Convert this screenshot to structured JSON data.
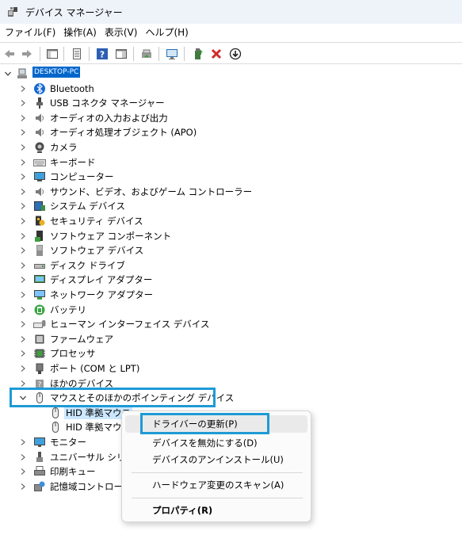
{
  "window": {
    "title": "デバイス マネージャー"
  },
  "menu": [
    "ファイル(F)",
    "操作(A)",
    "表示(V)",
    "ヘルプ(H)"
  ],
  "toolbar": {
    "icons": [
      "back-arrow-icon",
      "forward-arrow-icon",
      "show-hide-console-tree-icon",
      "properties-icon",
      "help-icon",
      "action-pane-icon",
      "update-driver-icon",
      "scan-hardware-icon",
      "enable-device-icon",
      "uninstall-device-icon",
      "disable-device-icon"
    ]
  },
  "tree": {
    "root_label": "DESKTOP-PC",
    "categories": [
      {
        "label": "Bluetooth",
        "icon": "bluetooth-icon"
      },
      {
        "label": "USB コネクタ マネージャー",
        "icon": "usb-connector-icon"
      },
      {
        "label": "オーディオの入力および出力",
        "icon": "speaker-icon"
      },
      {
        "label": "オーディオ処理オブジェクト (APO)",
        "icon": "speaker-icon"
      },
      {
        "label": "カメラ",
        "icon": "camera-icon"
      },
      {
        "label": "キーボード",
        "icon": "keyboard-icon"
      },
      {
        "label": "コンピューター",
        "icon": "computer-icon"
      },
      {
        "label": "サウンド、ビデオ、およびゲーム コントローラー",
        "icon": "speaker-icon"
      },
      {
        "label": "システム デバイス",
        "icon": "system-devices-icon"
      },
      {
        "label": "セキュリティ デバイス",
        "icon": "security-device-icon"
      },
      {
        "label": "ソフトウェア コンポーネント",
        "icon": "software-component-icon"
      },
      {
        "label": "ソフトウェア デバイス",
        "icon": "software-device-icon"
      },
      {
        "label": "ディスク ドライブ",
        "icon": "disk-drive-icon"
      },
      {
        "label": "ディスプレイ アダプター",
        "icon": "display-adapter-icon"
      },
      {
        "label": "ネットワーク アダプター",
        "icon": "network-adapter-icon"
      },
      {
        "label": "バッテリ",
        "icon": "battery-icon"
      },
      {
        "label": "ヒューマン インターフェイス デバイス",
        "icon": "hid-icon"
      },
      {
        "label": "ファームウェア",
        "icon": "firmware-icon"
      },
      {
        "label": "プロセッサ",
        "icon": "processor-icon"
      },
      {
        "label": "ポート (COM と LPT)",
        "icon": "port-icon"
      },
      {
        "label": "ほかのデバイス",
        "icon": "other-devices-icon"
      },
      {
        "label": "マウスとそのほかのポインティング デバイス",
        "icon": "mouse-icon",
        "expanded": true
      },
      {
        "label": "HID 準拠マウス",
        "icon": "mouse-icon",
        "child": true,
        "selected": true
      },
      {
        "label": "HID 準拠マウス",
        "icon": "mouse-icon",
        "child": true
      },
      {
        "label": "モニター",
        "icon": "monitor-icon"
      },
      {
        "label": "ユニバーサル シリアル バス コントローラー",
        "icon": "usb-controller-icon"
      },
      {
        "label": "印刷キュー",
        "icon": "printer-icon"
      },
      {
        "label": "記憶域コントローラー",
        "icon": "storage-controller-icon"
      }
    ]
  },
  "context_menu": {
    "update_driver": "ドライバーの更新(P)",
    "disable_device": "デバイスを無効にする(D)",
    "uninstall_device": "デバイスのアンインストール(U)",
    "scan_hardware": "ハードウェア変更のスキャン(A)",
    "properties": "プロパティ(R)"
  },
  "colors": {
    "highlight": "#1e9ad6",
    "selection": "#cce8ff"
  }
}
